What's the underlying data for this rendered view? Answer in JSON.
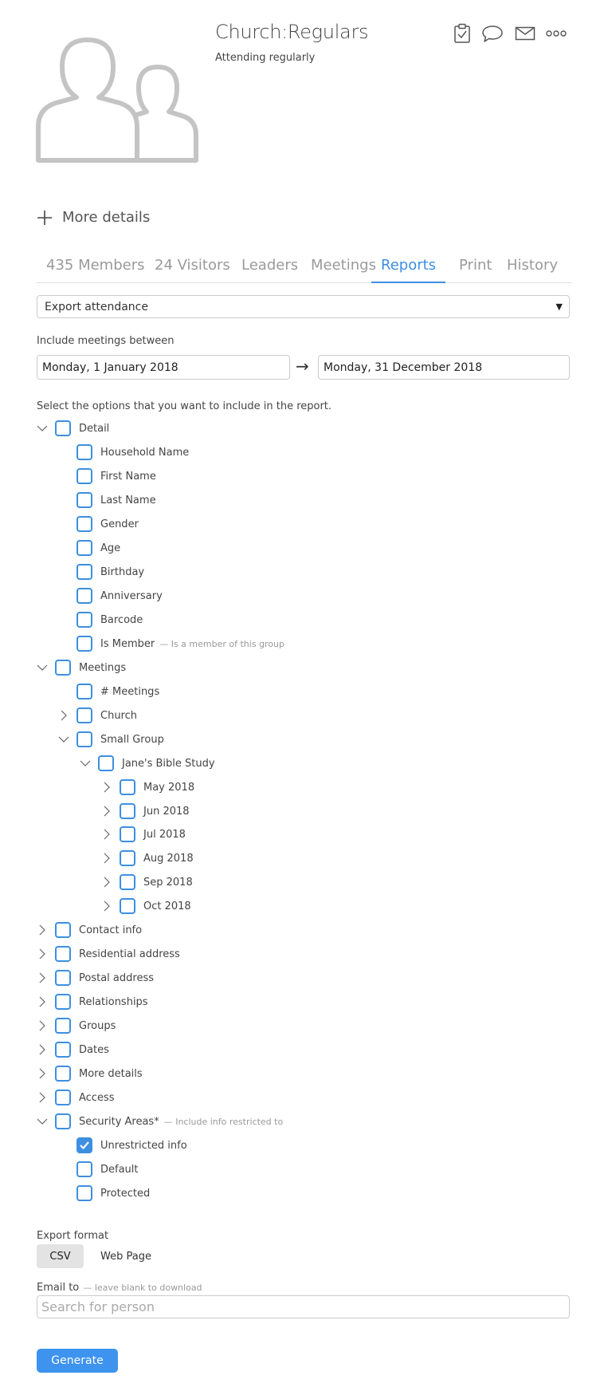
{
  "header": {
    "title": "Church:Regulars",
    "subtitle": "Attending regularly",
    "icons": [
      "clipboard-icon",
      "chat-icon",
      "mail-icon",
      "more-icon"
    ]
  },
  "more_details_label": "More details",
  "tabs": [
    {
      "label": "435 Members"
    },
    {
      "label": "24 Visitors"
    },
    {
      "label": "Leaders"
    },
    {
      "label": "Meetings"
    },
    {
      "label": "Reports",
      "active": true
    },
    {
      "label": "Print"
    },
    {
      "label": "History"
    }
  ],
  "report_select": {
    "value": "Export attendance"
  },
  "date_range": {
    "label": "Include meetings between",
    "start": "Monday, 1 January 2018",
    "arrow": "→",
    "end": "Monday, 31 December 2018"
  },
  "options_intro": "Select the options that you want to include in the report.",
  "tree": [
    {
      "label": "Detail",
      "level": 0,
      "expander": "expanded"
    },
    {
      "label": "Household Name",
      "level": 1,
      "expander": "none"
    },
    {
      "label": "First Name",
      "level": 1,
      "expander": "none"
    },
    {
      "label": "Last Name",
      "level": 1,
      "expander": "none"
    },
    {
      "label": "Gender",
      "level": 1,
      "expander": "none"
    },
    {
      "label": "Age",
      "level": 1,
      "expander": "none"
    },
    {
      "label": "Birthday",
      "level": 1,
      "expander": "none"
    },
    {
      "label": "Anniversary",
      "level": 1,
      "expander": "none"
    },
    {
      "label": "Barcode",
      "level": 1,
      "expander": "none"
    },
    {
      "label": "Is Member",
      "note": "— Is a member of this group",
      "level": 1,
      "expander": "none"
    },
    {
      "label": "Meetings",
      "level": 0,
      "expander": "expanded"
    },
    {
      "label": "# Meetings",
      "level": 1,
      "expander": "none"
    },
    {
      "label": "Church",
      "level": 1,
      "expander": "collapsed"
    },
    {
      "label": "Small Group",
      "level": 1,
      "expander": "expanded"
    },
    {
      "label": "Jane's Bible Study",
      "level": 2,
      "expander": "expanded"
    },
    {
      "label": "May 2018",
      "level": 3,
      "expander": "collapsed"
    },
    {
      "label": "Jun 2018",
      "level": 3,
      "expander": "collapsed"
    },
    {
      "label": "Jul 2018",
      "level": 3,
      "expander": "collapsed"
    },
    {
      "label": "Aug 2018",
      "level": 3,
      "expander": "collapsed"
    },
    {
      "label": "Sep 2018",
      "level": 3,
      "expander": "collapsed"
    },
    {
      "label": "Oct 2018",
      "level": 3,
      "expander": "collapsed"
    },
    {
      "label": "Contact info",
      "level": 0,
      "expander": "collapsed"
    },
    {
      "label": "Residential address",
      "level": 0,
      "expander": "collapsed"
    },
    {
      "label": "Postal address",
      "level": 0,
      "expander": "collapsed"
    },
    {
      "label": "Relationships",
      "level": 0,
      "expander": "collapsed"
    },
    {
      "label": "Groups",
      "level": 0,
      "expander": "collapsed"
    },
    {
      "label": "Dates",
      "level": 0,
      "expander": "collapsed"
    },
    {
      "label": "More details",
      "level": 0,
      "expander": "collapsed"
    },
    {
      "label": "Access",
      "level": 0,
      "expander": "collapsed"
    },
    {
      "label": "Security Areas*",
      "note": "— Include info restricted to",
      "level": 0,
      "expander": "expanded"
    },
    {
      "label": "Unrestricted info",
      "level": 1,
      "expander": "none",
      "checked": true
    },
    {
      "label": "Default",
      "level": 1,
      "expander": "none"
    },
    {
      "label": "Protected",
      "level": 1,
      "expander": "none"
    }
  ],
  "export_format": {
    "label": "Export format",
    "options": [
      "CSV",
      "Web Page"
    ],
    "selected": "CSV"
  },
  "email_to": {
    "label": "Email to",
    "note": "— leave blank to download",
    "placeholder": "Search for person"
  },
  "generate_label": "Generate",
  "colors": {
    "accent": "#3d8fe0",
    "button": "#3d93ee",
    "muted": "#9a9a9a"
  }
}
